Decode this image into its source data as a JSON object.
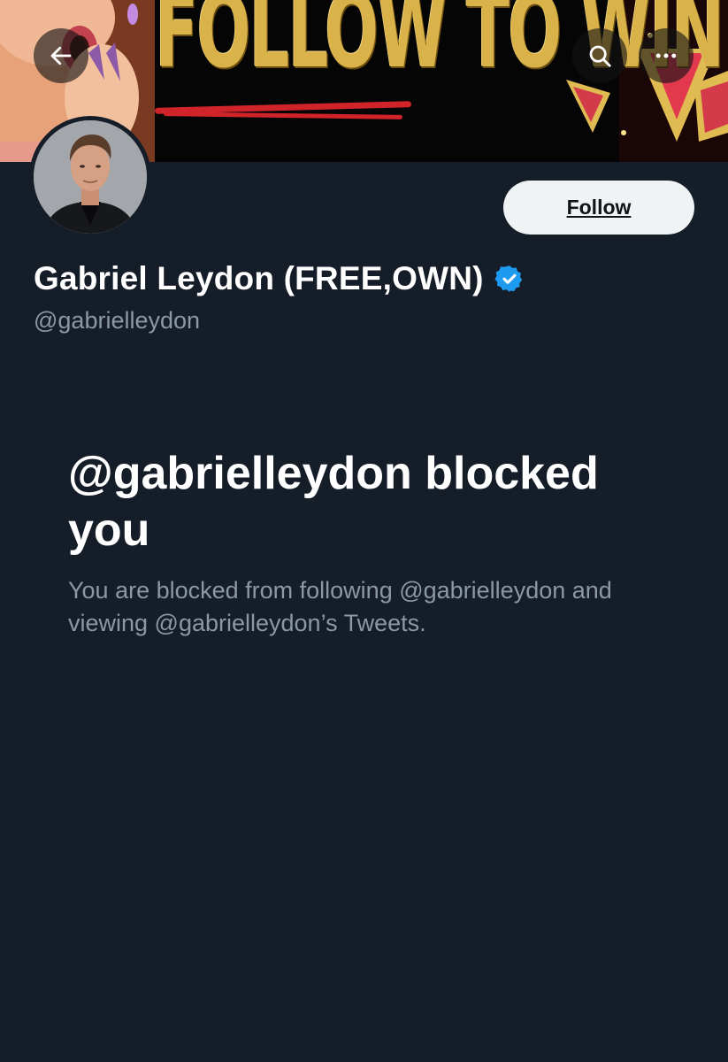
{
  "banner": {
    "headline": "FOLLOW TO WIN"
  },
  "icons": {
    "back": "arrow-left-icon",
    "search": "search-icon",
    "more": "more-horizontal-icon",
    "verified": "verified-badge-icon"
  },
  "profile": {
    "display_name": "Gabriel Leydon (FREE,OWN)",
    "handle": "@gabrielleydon",
    "follow_label": "Follow"
  },
  "blocked": {
    "title": "@gabrielleydon blocked you",
    "description": "You are blocked from following @gabrielleydon and viewing @gabrielleydon’s Tweets."
  },
  "colors": {
    "background": "#151d28",
    "secondary_text": "#8b98a5",
    "verified": "#1d9bf0",
    "follow_bg": "#eff3f4"
  }
}
